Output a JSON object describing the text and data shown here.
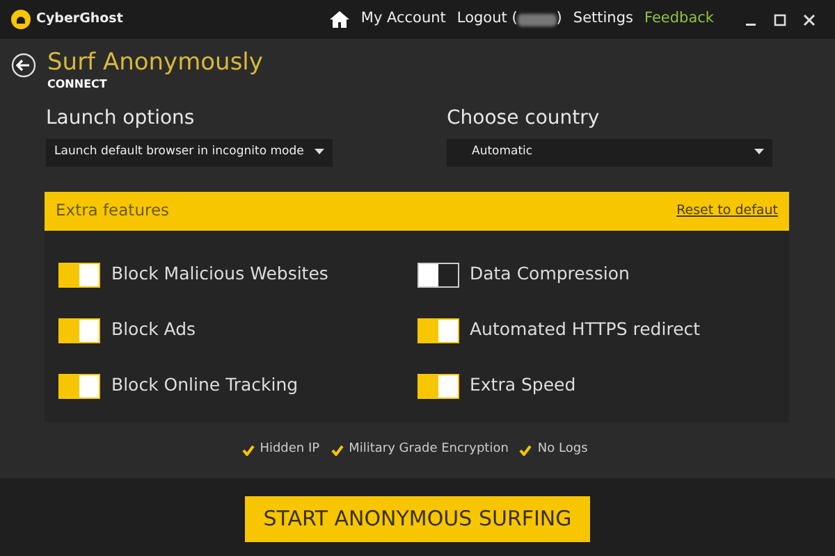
{
  "app": {
    "name": "CyberGhost"
  },
  "nav": {
    "account": "My Account",
    "logout_prefix": "Logout (",
    "logout_suffix": ")",
    "settings": "Settings",
    "feedback": "Feedback"
  },
  "page": {
    "title": "Surf Anonymously",
    "subtitle": "CONNECT"
  },
  "launch": {
    "label": "Launch options",
    "value": "Launch default browser in incognito mode"
  },
  "country": {
    "label": "Choose country",
    "value": "Automatic"
  },
  "extra": {
    "title": "Extra features",
    "reset": "Reset to defaut",
    "features": [
      {
        "label": "Block Malicious Websites",
        "on": true
      },
      {
        "label": "Data Compression",
        "on": false
      },
      {
        "label": "Block Ads",
        "on": true
      },
      {
        "label": "Automated HTTPS redirect",
        "on": true
      },
      {
        "label": "Block Online Tracking",
        "on": true
      },
      {
        "label": "Extra Speed",
        "on": true
      }
    ]
  },
  "benefits": [
    "Hidden IP",
    "Military Grade Encryption",
    "No Logs"
  ],
  "start": "START ANONYMOUS SURFING"
}
